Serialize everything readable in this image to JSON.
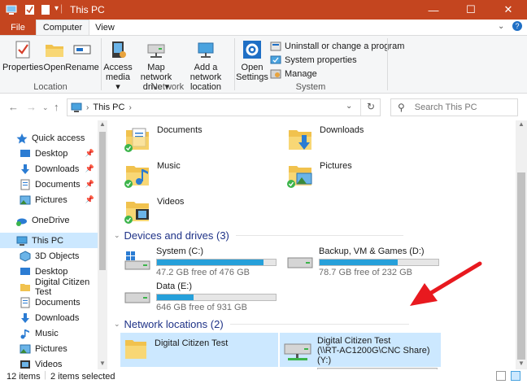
{
  "window": {
    "title": "This PC",
    "controls": {
      "minimize": "—",
      "maximize": "☐",
      "close": "✕"
    }
  },
  "tabs": [
    {
      "label": "File"
    },
    {
      "label": "Computer"
    },
    {
      "label": "View"
    }
  ],
  "ribbon": {
    "location": {
      "label": "Location",
      "buttons": [
        {
          "label": "Properties"
        },
        {
          "label": "Open"
        },
        {
          "label": "Rename"
        }
      ]
    },
    "network": {
      "label": "Network",
      "buttons": [
        {
          "label": "Access\nmedia ▾"
        },
        {
          "label": "Map network\ndrive ▾"
        },
        {
          "label": "Add a network\nlocation"
        }
      ]
    },
    "system": {
      "label": "System",
      "open_settings": "Open\nSettings",
      "commands": [
        {
          "label": "Uninstall or change a program"
        },
        {
          "label": "System properties"
        },
        {
          "label": "Manage"
        }
      ]
    }
  },
  "address": {
    "path": "This PC",
    "search_placeholder": "Search This PC"
  },
  "nav_pane": {
    "items": [
      {
        "label": "Quick access",
        "icon": "star-icon"
      },
      {
        "label": "Desktop",
        "icon": "desktop-icon",
        "pinned": true
      },
      {
        "label": "Downloads",
        "icon": "download-icon",
        "pinned": true
      },
      {
        "label": "Documents",
        "icon": "documents-icon",
        "pinned": true
      },
      {
        "label": "Pictures",
        "icon": "pictures-icon",
        "pinned": true
      },
      {
        "label": "OneDrive",
        "icon": "cloud-icon"
      },
      {
        "label": "This PC",
        "icon": "computer-icon",
        "selected": true
      },
      {
        "label": "3D Objects",
        "icon": "cube-icon"
      },
      {
        "label": "Desktop",
        "icon": "desktop-icon"
      },
      {
        "label": "Digital Citizen Test",
        "icon": "folder-icon"
      },
      {
        "label": "Documents",
        "icon": "documents-icon"
      },
      {
        "label": "Downloads",
        "icon": "download-icon"
      },
      {
        "label": "Music",
        "icon": "music-icon"
      },
      {
        "label": "Pictures",
        "icon": "pictures-icon"
      },
      {
        "label": "Videos",
        "icon": "videos-icon"
      }
    ]
  },
  "folders": [
    {
      "name": "Documents"
    },
    {
      "name": "Downloads"
    },
    {
      "name": "Music"
    },
    {
      "name": "Pictures"
    },
    {
      "name": "Videos"
    }
  ],
  "devices": {
    "heading": "Devices and drives (3)",
    "drives": [
      {
        "name": "System (C:)",
        "free": "47.2 GB free of 476 GB",
        "used_fraction": 0.9
      },
      {
        "name": "Backup, VM & Games (D:)",
        "free": "78.7 GB free of 232 GB",
        "used_fraction": 0.66
      },
      {
        "name": "Data (E:)",
        "free": "646 GB free of 931 GB",
        "used_fraction": 0.31
      }
    ]
  },
  "network": {
    "heading": "Network locations (2)",
    "items": [
      {
        "name": "Digital Citizen Test"
      },
      {
        "name": "Digital Citizen Test",
        "sub": "(\\\\RT-AC1200G\\CNC Share) (Y:)"
      }
    ]
  },
  "status": {
    "items": "12 items",
    "selected": "2 items selected"
  },
  "colors": {
    "titlebar": "#c4451f",
    "accent": "#26a0da",
    "selection": "#cce8ff",
    "heading": "#1e3287",
    "arrow": "#e8191f"
  }
}
